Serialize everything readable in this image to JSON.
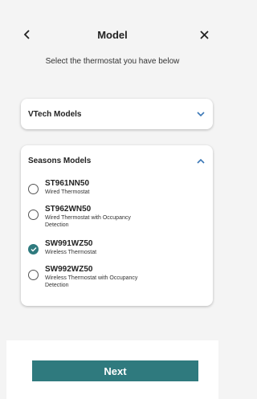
{
  "header": {
    "title": "Model",
    "subtitle": "Select the thermostat you have below",
    "back_icon": "chevron-left-icon",
    "close_icon": "close-icon"
  },
  "vtech": {
    "title": "VTech Models",
    "expanded": false,
    "chevron_icon": "chevron-down-icon"
  },
  "seasons": {
    "title": "Seasons Models",
    "expanded": true,
    "chevron_icon": "chevron-up-icon",
    "options": [
      {
        "name": "ST961NN50",
        "desc_lines": [
          "Wired Thermostat"
        ],
        "selected": false
      },
      {
        "name": "ST962WN50",
        "desc_lines": [
          "Wired Thermostat with Occupancy",
          "Detection"
        ],
        "selected": false
      },
      {
        "name": "SW991WZ50",
        "desc_lines": [
          "Wireless Thermostat"
        ],
        "selected": true
      },
      {
        "name": "SW992WZ50",
        "desc_lines": [
          "Wireless Thermostat with Occupancy",
          "Detection"
        ],
        "selected": false
      }
    ]
  },
  "footer": {
    "next_label": "Next"
  },
  "colors": {
    "accent": "#2f7a7e",
    "chevron": "#3b78b6",
    "background": "#f4f4f4"
  }
}
